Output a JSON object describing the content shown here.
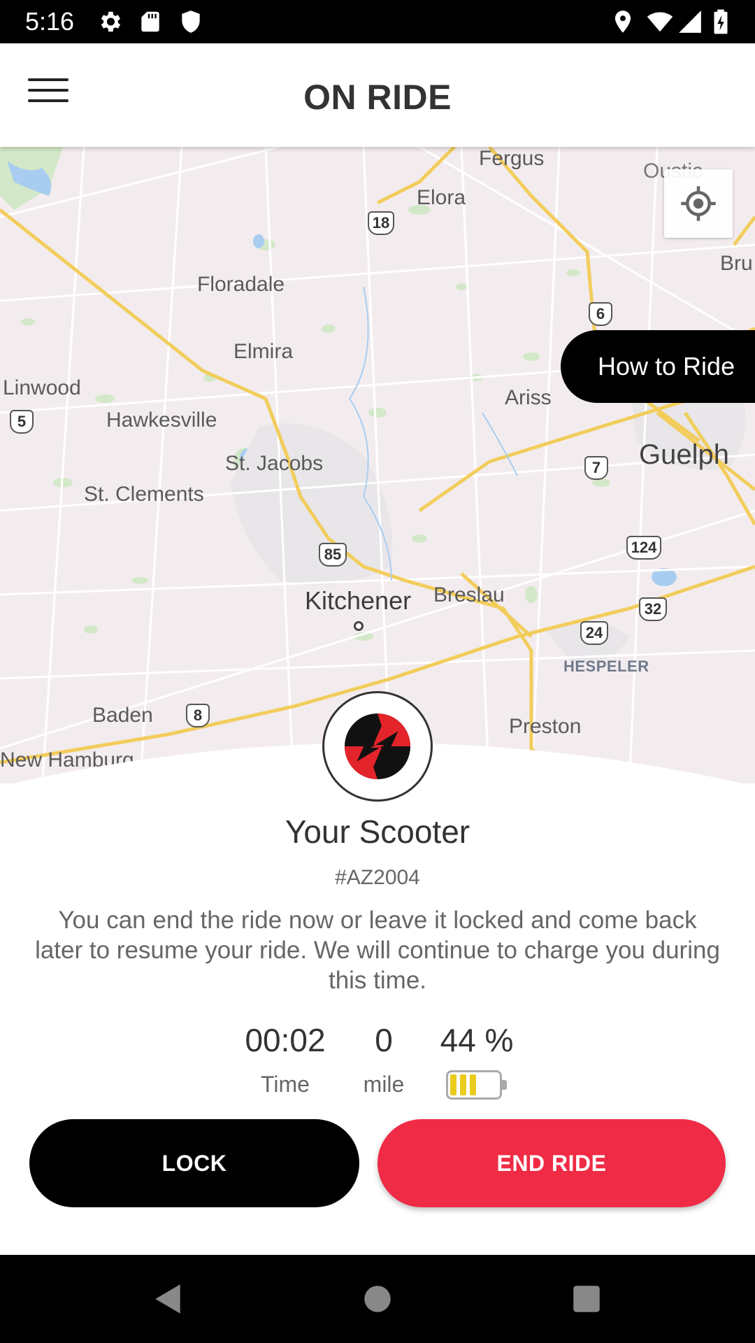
{
  "status_bar": {
    "time": "5:16",
    "icons": [
      "settings-icon",
      "sd-card-icon",
      "shield-icon",
      "location-icon",
      "wifi-icon",
      "signal-icon",
      "battery-charging-icon"
    ]
  },
  "app_bar": {
    "title": "ON RIDE",
    "menu_icon": "hamburger-menu-icon"
  },
  "map": {
    "places": {
      "fergus": "Fergus",
      "elora": "Elora",
      "oustic": "Oustic",
      "bru": "Bru",
      "floradale": "Floradale",
      "elmira": "Elmira",
      "linwood": "Linwood",
      "hawkesville": "Hawkesville",
      "ariss": "Ariss",
      "guelph": "Guelph",
      "st_jacobs": "St. Jacobs",
      "st_clements": "St. Clements",
      "kitchener": "Kitchener",
      "breslau": "Breslau",
      "hespeler": "HESPELER",
      "baden": "Baden",
      "preston": "Preston",
      "new_hamburg": "New Hamburg"
    },
    "routes": {
      "r18": "18",
      "r6": "6",
      "r5": "5",
      "r7": "7",
      "r85": "85",
      "r124": "124",
      "r32": "32",
      "r24": "24",
      "r8": "8"
    },
    "locate_icon": "my-location-icon",
    "how_to_ride": "How to Ride"
  },
  "ride": {
    "logo_icon": "brand-logo-icon",
    "title": "Your Scooter",
    "scooter_id": "#AZ2004",
    "message": "You can end the ride now or leave it locked and come back later to resume your ride. We will continue to charge you during this time.",
    "time_value": "00:02",
    "time_label": "Time",
    "distance_value": "0",
    "distance_label": "mile",
    "battery_value": "44 %",
    "battery_level": 0.44,
    "battery_color": "#e9cc1f"
  },
  "actions": {
    "lock": "LOCK",
    "end_ride": "END RIDE",
    "end_ride_color": "#ef2b45"
  },
  "nav_bar": {
    "icons": [
      "back-icon",
      "home-icon",
      "recents-icon"
    ]
  }
}
